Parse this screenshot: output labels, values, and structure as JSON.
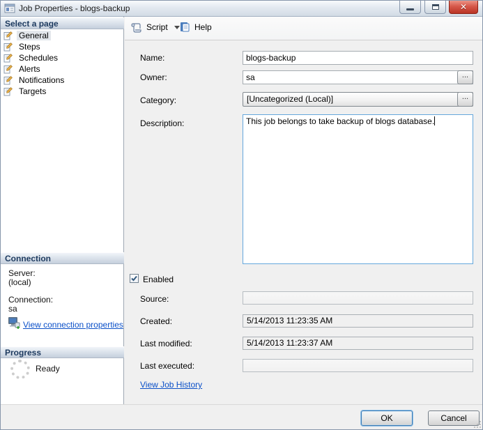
{
  "window": {
    "title": "Job Properties - blogs-backup",
    "controls": {
      "minimize": "minimize",
      "maximize": "maximize",
      "close": "close"
    }
  },
  "sidebar": {
    "select_page": {
      "header": "Select a page",
      "items": [
        {
          "label": "General",
          "selected": true
        },
        {
          "label": "Steps",
          "selected": false
        },
        {
          "label": "Schedules",
          "selected": false
        },
        {
          "label": "Alerts",
          "selected": false
        },
        {
          "label": "Notifications",
          "selected": false
        },
        {
          "label": "Targets",
          "selected": false
        }
      ]
    },
    "connection": {
      "header": "Connection",
      "server_label": "Server:",
      "server_value": "(local)",
      "connection_label": "Connection:",
      "connection_value": "sa",
      "link": "View connection properties"
    },
    "progress": {
      "header": "Progress",
      "status": "Ready"
    }
  },
  "toolbar": {
    "script_label": "Script",
    "help_label": "Help"
  },
  "form": {
    "name": {
      "label": "Name:",
      "value": "blogs-backup"
    },
    "owner": {
      "label": "Owner:",
      "value": "sa",
      "browse": "..."
    },
    "category": {
      "label": "Category:",
      "value": "[Uncategorized (Local)]",
      "browse": "..."
    },
    "description": {
      "label": "Description:",
      "value": "This job belongs to take backup of blogs database."
    },
    "enabled": {
      "label": "Enabled",
      "checked": true
    },
    "source": {
      "label": "Source:",
      "value": ""
    },
    "created": {
      "label": "Created:",
      "value": "5/14/2013 11:23:35 AM"
    },
    "last_modified": {
      "label": "Last modified:",
      "value": "5/14/2013 11:23:37 AM"
    },
    "last_executed": {
      "label": "Last executed:",
      "value": ""
    },
    "history_link": "View Job History"
  },
  "footer": {
    "ok": "OK",
    "cancel": "Cancel"
  },
  "colors": {
    "link_blue": "#0b50c8",
    "close_red": "#c0392b",
    "header_navy": "#1d3a5f",
    "focus_blue": "#64a7dc",
    "panel_gray": "#f0f0f0"
  }
}
